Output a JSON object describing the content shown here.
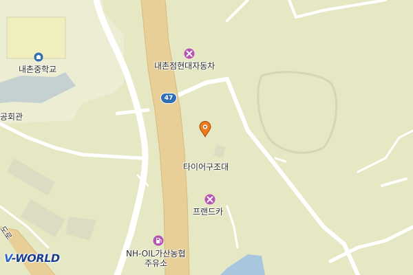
{
  "map": {
    "route_shield": "47",
    "labels": {
      "school": "내촌중학교",
      "hall_fragment": "공회관",
      "repair_shop_1": "내촌점현대자동차",
      "tire_facility": "타이어구조대",
      "repair_shop_2": "프랜드카",
      "gas_station_line1": "NH-OIL가산농협",
      "gas_station_line2": "주유소",
      "road_fragment": "도로"
    },
    "icons": {
      "school": "school-icon",
      "repair_1": "wrench-tools-icon",
      "repair_2": "wrench-tools-icon",
      "gas": "gas-station-icon",
      "marker": "location-pin-icon"
    },
    "colors": {
      "background": "#e6e8c4",
      "highway": "#e8cf98",
      "poi_repair": "#b653b4",
      "poi_school": "#2f6db5",
      "marker": "#f07b1c"
    }
  },
  "branding": {
    "logo_prefix": "V",
    "logo_text": "-WORLD"
  }
}
